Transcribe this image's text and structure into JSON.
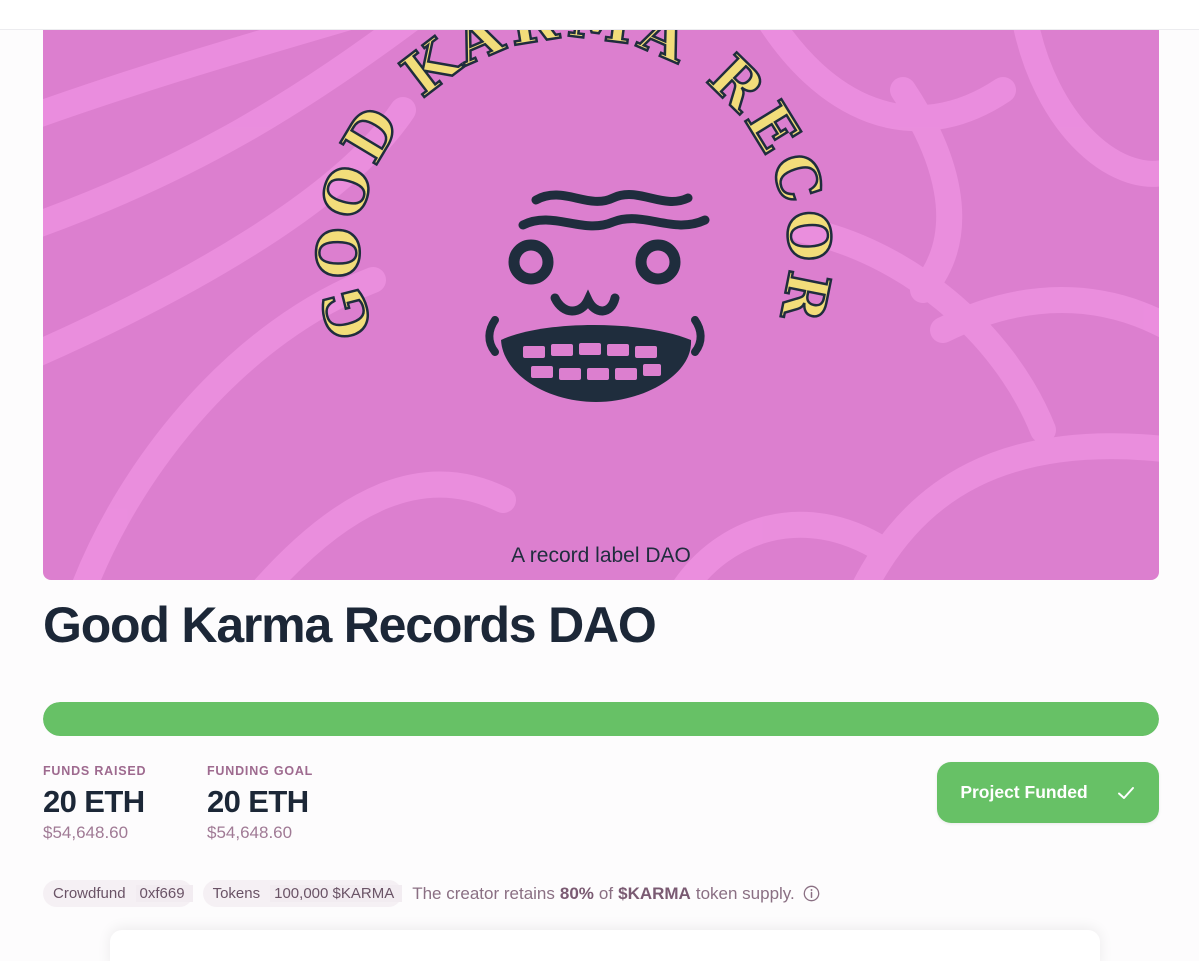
{
  "hero": {
    "arc_text": "GOOD KARMA RECORDS",
    "subtitle": "A record label DAO"
  },
  "project": {
    "title": "Good Karma Records DAO",
    "progress_fraction": 1.0
  },
  "stats": {
    "raised": {
      "label": "FUNDS RAISED",
      "value": "20 ETH",
      "usd": "$54,648.60"
    },
    "goal": {
      "label": "FUNDING GOAL",
      "value": "20 ETH",
      "usd": "$54,648.60"
    }
  },
  "status_button": {
    "label": "Project Funded",
    "icon": "check-icon"
  },
  "meta": {
    "crowdfund_label": "Crowdfund",
    "crowdfund_address": "0xf669",
    "tokens_label": "Tokens",
    "tokens_value": "100,000 $KARMA",
    "note_prefix": "The creator retains",
    "note_percent": "80%",
    "note_of": "of",
    "note_token": "$KARMA",
    "note_suffix": "token supply.",
    "info_icon": "info-icon"
  },
  "colors": {
    "hero_bg": "#dc7fcf",
    "hero_swirl": "#ec90df",
    "arc_text": "#f2dd7a",
    "face": "#1f2d3d",
    "progress": "#67c166",
    "button": "#67c166"
  }
}
